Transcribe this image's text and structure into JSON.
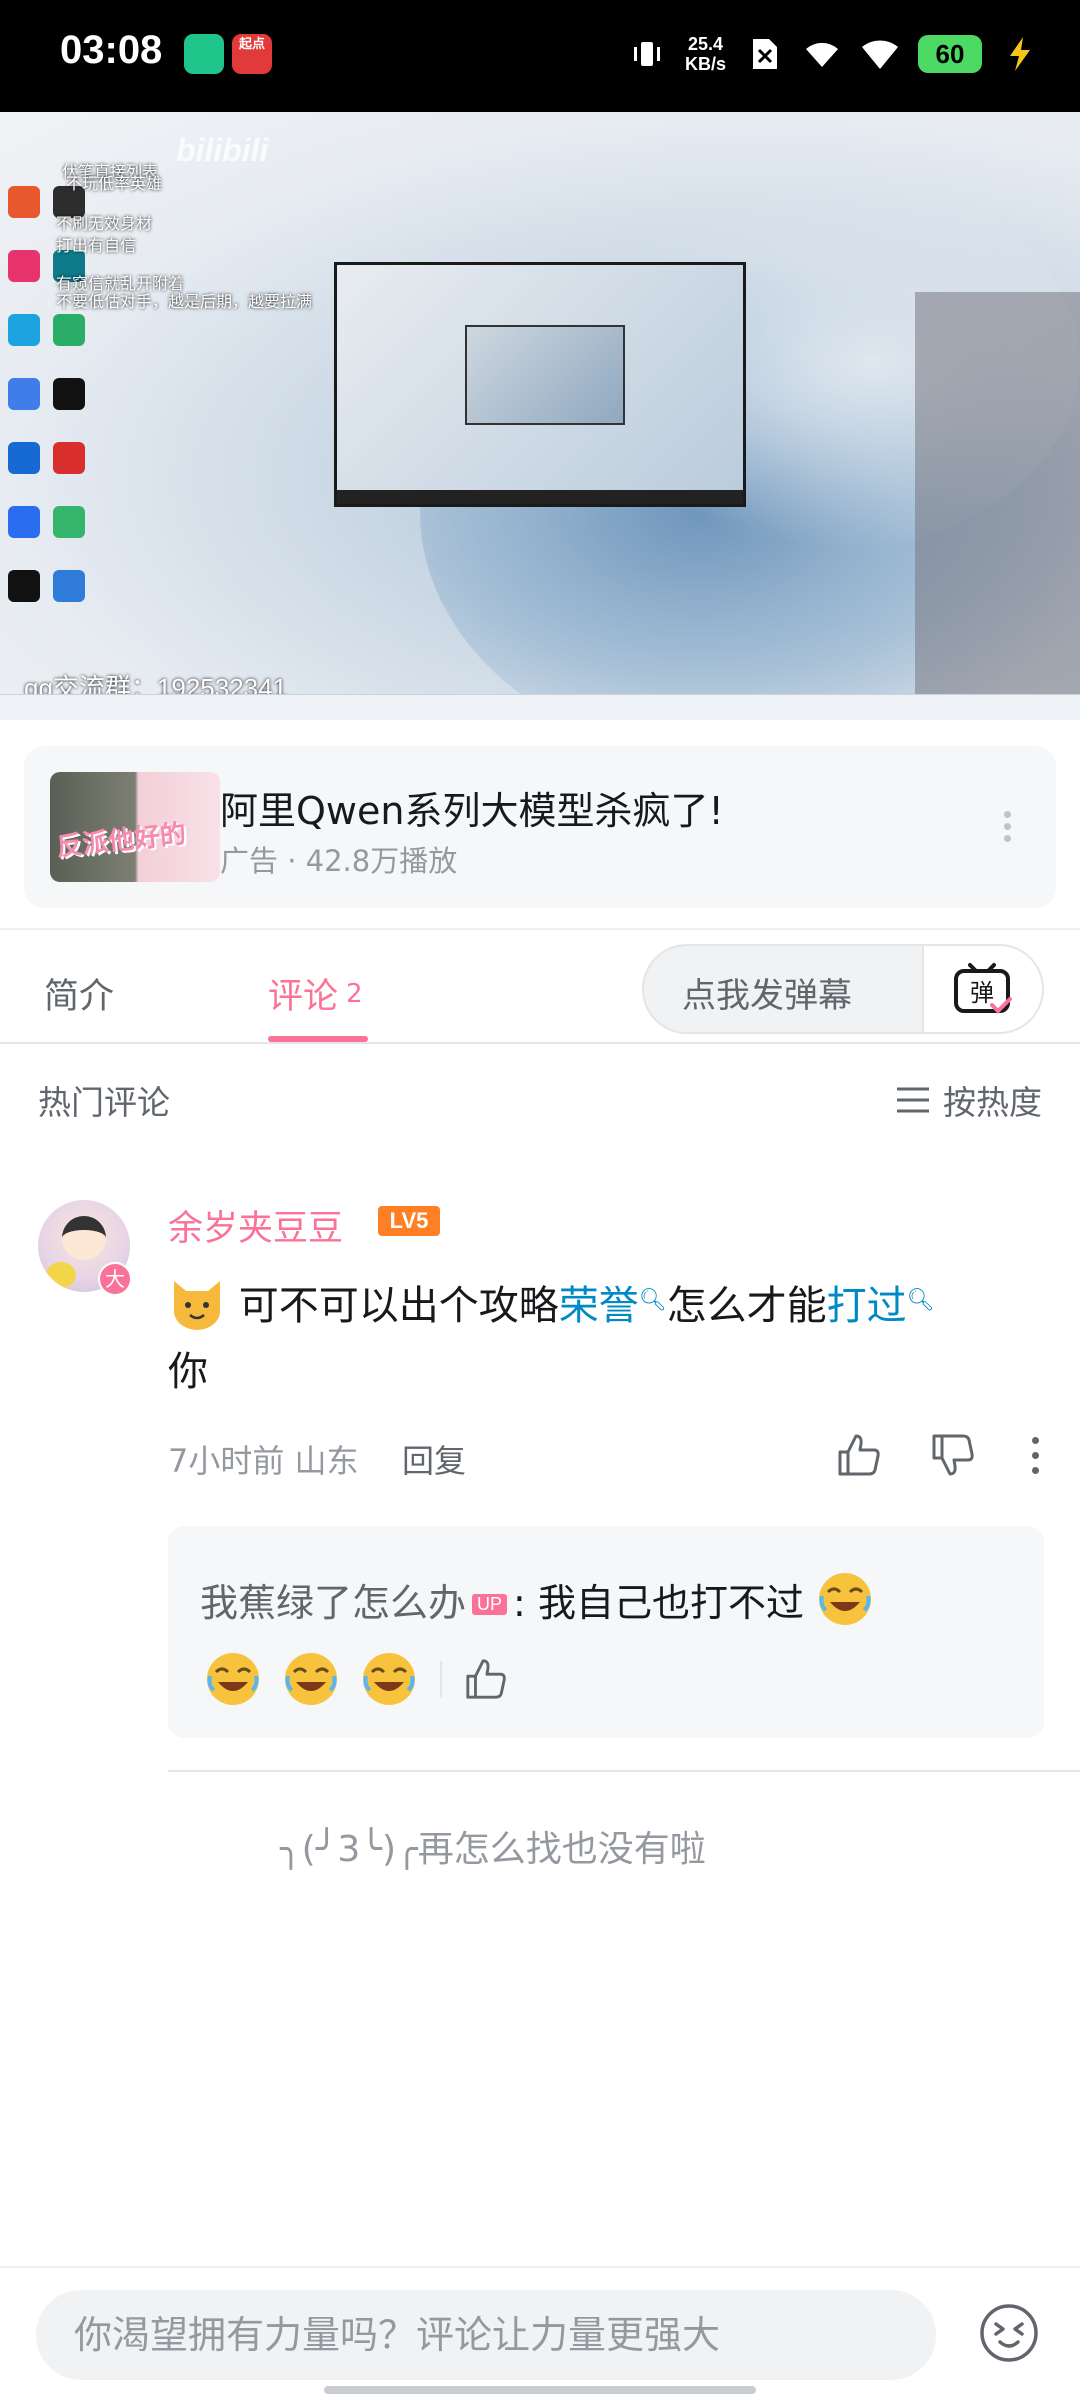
{
  "status_bar": {
    "time": "03:08",
    "app_badge": "起点",
    "net_speed_value": "25.4",
    "net_speed_unit": "KB/s",
    "battery": "60"
  },
  "video": {
    "overlay_text": [
      "伏笔直接列表",
      "不玩低率英雄",
      "不刷无效身材",
      "打出有自信",
      "有窥信就乱开附着",
      "不要低估对手，越是后期，越要拉满"
    ],
    "logo": "bilibili",
    "qq_group": "qq交流群：192532341"
  },
  "ad": {
    "thumb_text": "反派他好的",
    "title": "阿里Qwen系列大模型杀疯了!",
    "subtitle": "广告 · 42.8万播放"
  },
  "tabs": {
    "intro": "简介",
    "comments": "评论",
    "comments_count": "2",
    "danmaku_placeholder": "点我发弹幕",
    "danmaku_button": "弹"
  },
  "comments_header": {
    "hot": "热门评论",
    "sort": "按热度"
  },
  "comment": {
    "avatar_badge": "大",
    "username": "余岁夹豆豆",
    "level": "LV5",
    "text_part1": "可不可以出个攻略",
    "link1": "荣誉",
    "text_part2": "怎么才能",
    "link2": "打过",
    "text_part3": "你",
    "time_location": "7小时前 山东",
    "reply_label": "回复",
    "sub_reply": {
      "author": "我蕉绿了怎么办",
      "up_tag": "UP",
      "separator": ":",
      "text": "我自己也打不过"
    }
  },
  "end_message": "╮(╯3╰)╭再怎么找也没有啦",
  "input": {
    "placeholder": "你渴望拥有力量吗？评论让力量更强大"
  },
  "colors": {
    "brand_pink": "#fb7299",
    "link_blue": "#008ac5",
    "level_orange": "#ff7f24"
  }
}
